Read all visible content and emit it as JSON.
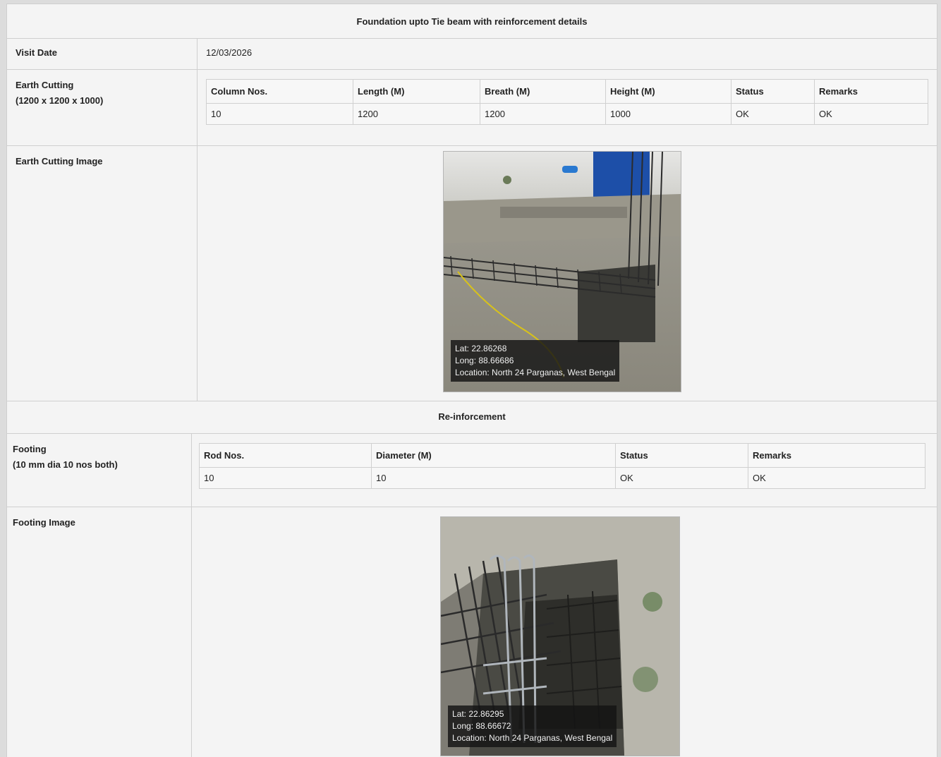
{
  "title": "Foundation upto Tie beam with reinforcement details",
  "visit_date": {
    "label": "Visit Date",
    "value": "12/03/2026"
  },
  "earth_cutting": {
    "label": "Earth Cutting",
    "sublabel": "(1200 x 1200 x 1000)",
    "headers": [
      "Column Nos.",
      "Length (M)",
      "Breath (M)",
      "Height (M)",
      "Status",
      "Remarks"
    ],
    "rows": [
      [
        "10",
        "1200",
        "1200",
        "1000",
        "OK",
        "OK"
      ]
    ]
  },
  "earth_cutting_image": {
    "label": "Earth Cutting Image",
    "lat": "Lat: 22.86268",
    "long": "Long: 88.66686",
    "location": "Location: North 24 Parganas, West Bengal"
  },
  "reinforcement_title": "Re-inforcement",
  "footing": {
    "label": "Footing",
    "sublabel": "(10 mm dia 10 nos both)",
    "headers": [
      "Rod Nos.",
      "Diameter (M)",
      "Status",
      "Remarks"
    ],
    "rows": [
      [
        "10",
        "10",
        "OK",
        "OK"
      ]
    ]
  },
  "footing_image": {
    "label": "Footing Image",
    "lat": "Lat: 22.86295",
    "long": "Long: 88.66672",
    "location": "Location: North 24 Parganas, West Bengal"
  }
}
